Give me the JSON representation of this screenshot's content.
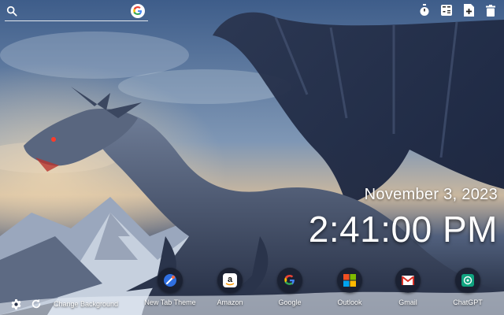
{
  "search": {
    "placeholder": "",
    "icon": "search-icon",
    "engine_icon": "google-g-icon"
  },
  "toolbar": {
    "items": [
      "stopwatch-icon",
      "calculator-icon",
      "add-note-icon",
      "trash-icon"
    ]
  },
  "clock": {
    "date": "November 3, 2023",
    "time": "2:41:00 PM"
  },
  "shortcuts": [
    {
      "label": "New Tab Theme",
      "icon": "new-tab-theme-icon"
    },
    {
      "label": "Amazon",
      "icon": "amazon-icon"
    },
    {
      "label": "Google",
      "icon": "google-icon"
    },
    {
      "label": "Outlook",
      "icon": "outlook-icon"
    },
    {
      "label": "Gmail",
      "icon": "gmail-icon"
    },
    {
      "label": "ChatGPT",
      "icon": "chatgpt-icon"
    }
  ],
  "bottom": {
    "settings_icon": "gear-icon",
    "refresh_icon": "refresh-icon",
    "change_background_label": "Change Background"
  },
  "colors": {
    "google_blue": "#4285F4",
    "google_red": "#EA4335",
    "google_yellow": "#FBBC05",
    "google_green": "#34A853",
    "gmail_red": "#D93025",
    "chatgpt_green": "#10A37F",
    "new_tab_theme_blue": "#2F6FE0"
  }
}
